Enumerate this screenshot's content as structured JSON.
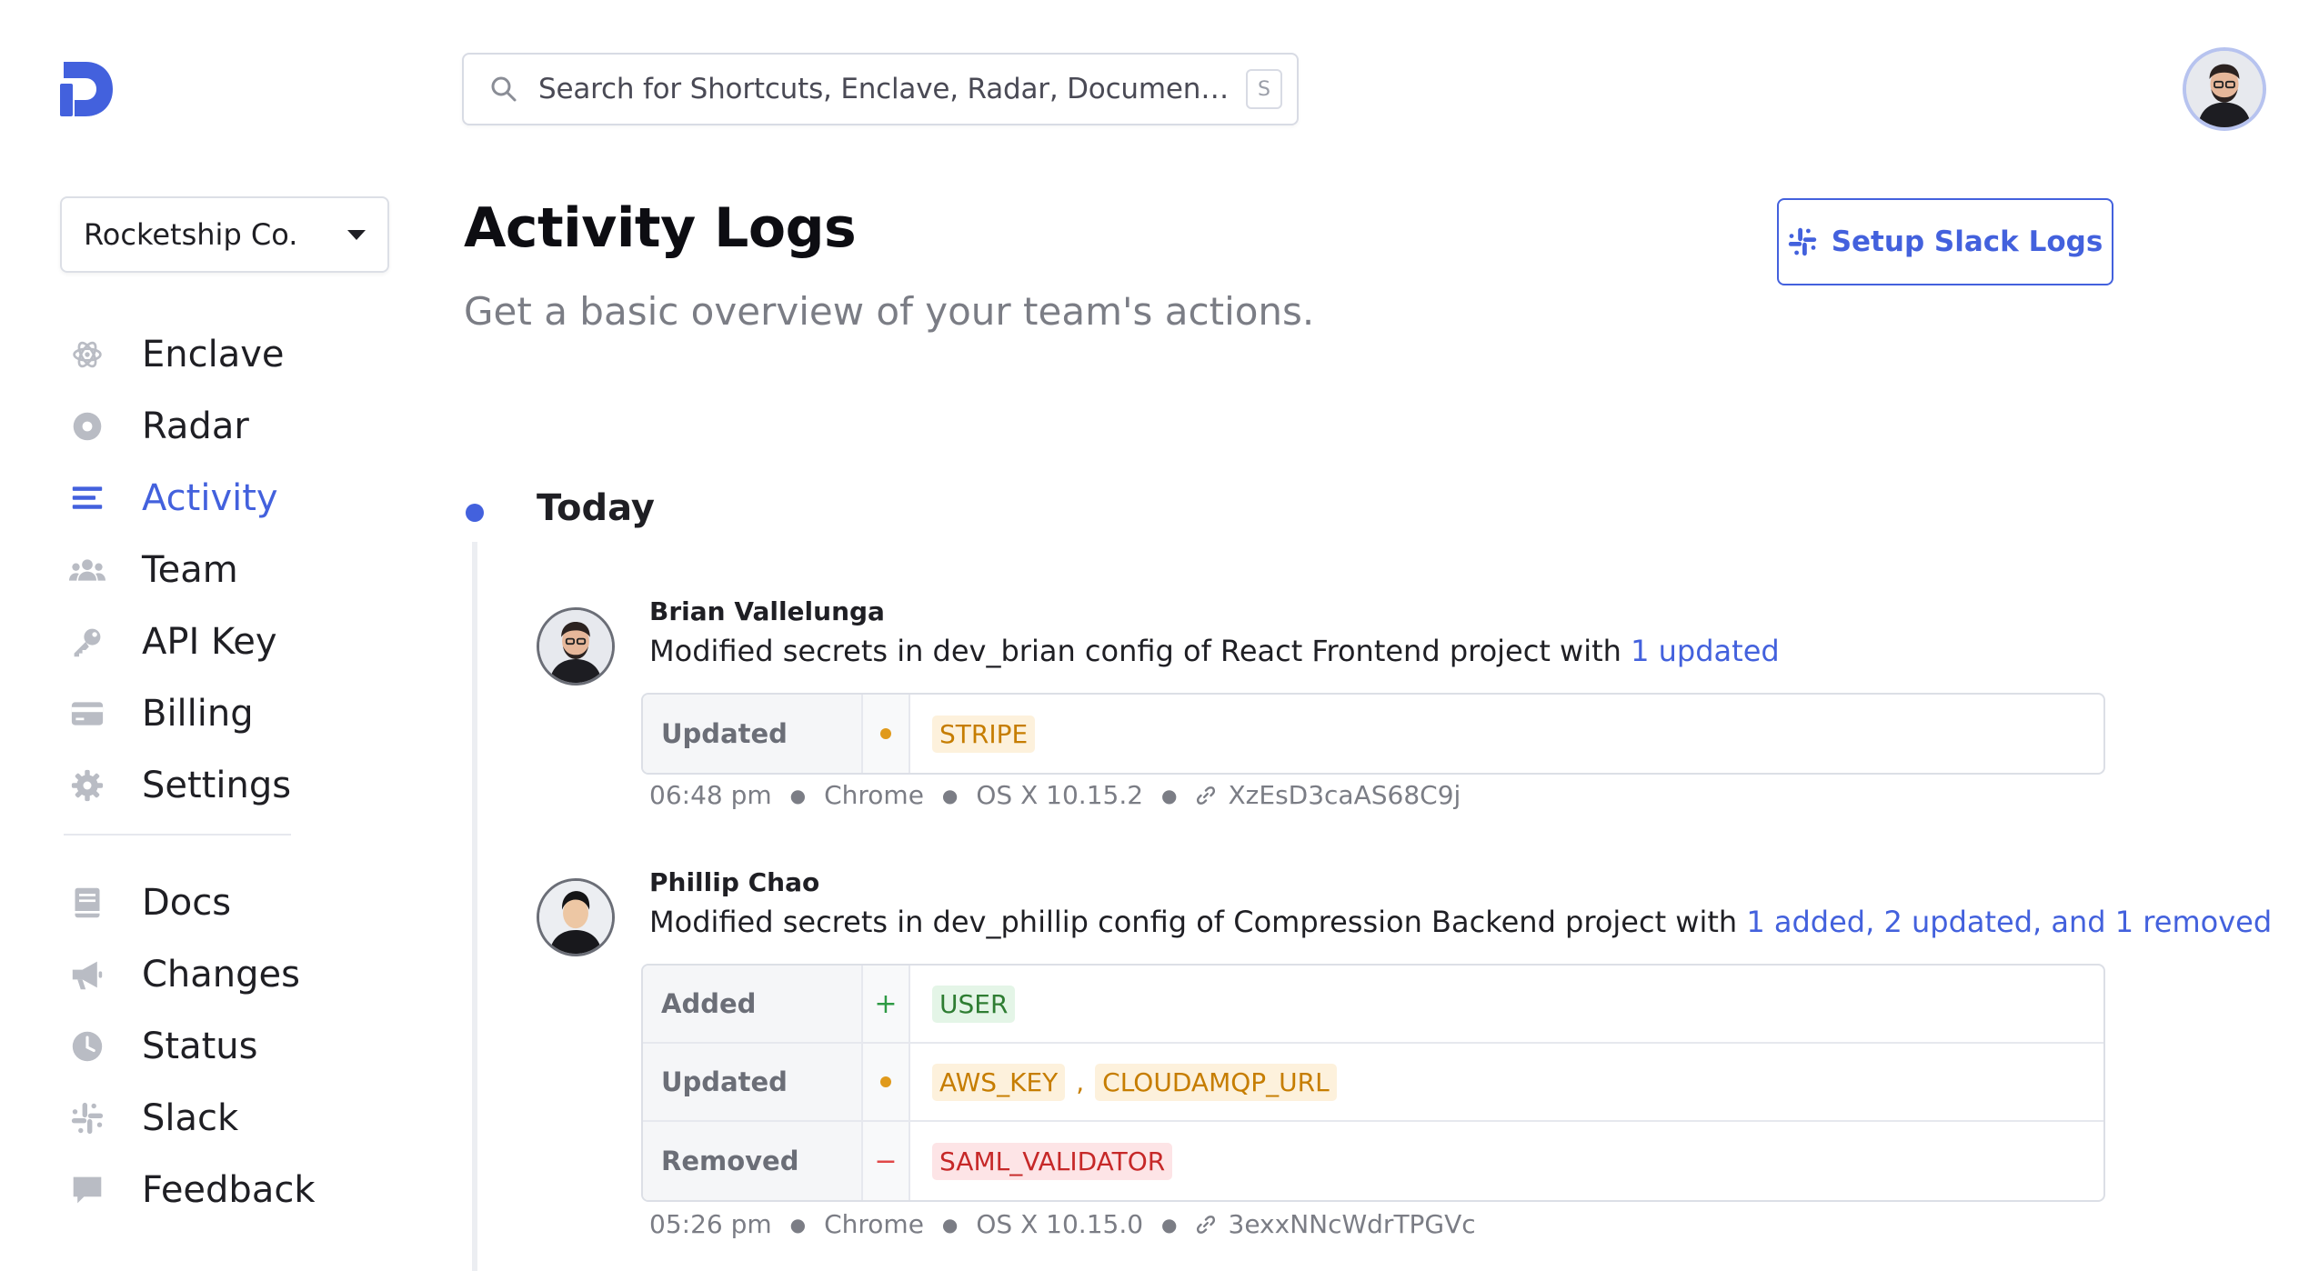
{
  "search": {
    "placeholder": "Search for Shortcuts, Enclave, Radar, Documentation...",
    "shortcut": "S"
  },
  "org": {
    "name": "Rocketship Co."
  },
  "nav": {
    "primary": [
      {
        "label": "Enclave",
        "icon": "atom-icon"
      },
      {
        "label": "Radar",
        "icon": "radar-icon"
      },
      {
        "label": "Activity",
        "icon": "list-icon",
        "active": true
      },
      {
        "label": "Team",
        "icon": "team-icon"
      },
      {
        "label": "API Key",
        "icon": "key-icon"
      },
      {
        "label": "Billing",
        "icon": "credit-card-icon"
      },
      {
        "label": "Settings",
        "icon": "gear-icon"
      }
    ],
    "secondary": [
      {
        "label": "Docs",
        "icon": "book-icon"
      },
      {
        "label": "Changes",
        "icon": "megaphone-icon"
      },
      {
        "label": "Status",
        "icon": "clock-icon"
      },
      {
        "label": "Slack",
        "icon": "slack-icon"
      },
      {
        "label": "Feedback",
        "icon": "chat-icon"
      }
    ]
  },
  "page": {
    "title": "Activity Logs",
    "subtitle": "Get a basic overview of your team's actions.",
    "slack_button": "Setup Slack Logs"
  },
  "timeline": {
    "section": "Today",
    "entries": [
      {
        "user": "Brian Vallelunga",
        "desc_prefix": "Modified secrets in dev_brian config of React Frontend project with ",
        "desc_link": "1 updated",
        "changes": [
          {
            "kind": "Updated",
            "keys": [
              "STRIPE"
            ]
          }
        ],
        "meta": {
          "time": "06:48 pm",
          "browser": "Chrome",
          "os": "OS X 10.15.2",
          "id": "XzEsD3caAS68C9j"
        }
      },
      {
        "user": "Phillip Chao",
        "desc_prefix": "Modified secrets in dev_phillip config of Compression Backend project with ",
        "desc_link": "1 added, 2 updated, and 1 removed",
        "changes": [
          {
            "kind": "Added",
            "keys": [
              "USER"
            ]
          },
          {
            "kind": "Updated",
            "keys": [
              "AWS_KEY",
              "CLOUDAMQP_URL"
            ]
          },
          {
            "kind": "Removed",
            "keys": [
              "SAML_VALIDATOR"
            ]
          }
        ],
        "meta": {
          "time": "05:26 pm",
          "browser": "Chrome",
          "os": "OS X 10.15.0",
          "id": "3exxNNcWdrTPGVc"
        }
      }
    ]
  },
  "colors": {
    "accent": "#4361dd",
    "updated": "#c67d00",
    "added": "#2e7d32",
    "removed": "#c62828"
  }
}
